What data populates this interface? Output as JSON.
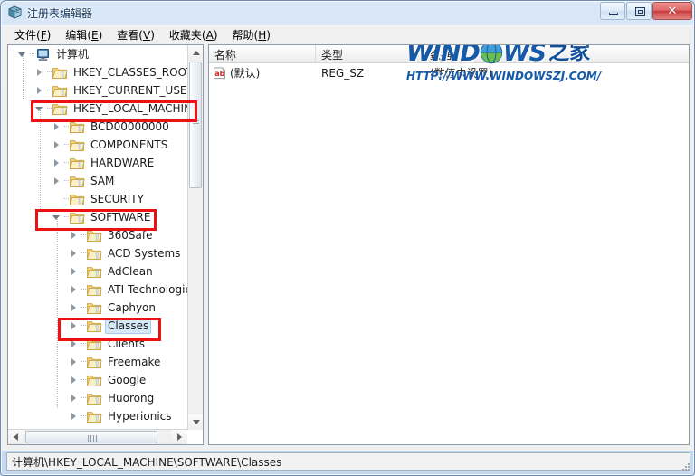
{
  "window": {
    "title": "注册表编辑器",
    "icon": "registry-editor-icon",
    "buttons": {
      "minimize": "最小化",
      "maximize": "还原",
      "close": "关闭",
      "close_glyph": "✕"
    }
  },
  "menubar": {
    "items": [
      {
        "label": "文件",
        "mnemonic": "F"
      },
      {
        "label": "编辑",
        "mnemonic": "E"
      },
      {
        "label": "查看",
        "mnemonic": "V"
      },
      {
        "label": "收藏夹",
        "mnemonic": "A"
      },
      {
        "label": "帮助",
        "mnemonic": "H"
      }
    ]
  },
  "tree": {
    "nodes": [
      {
        "label": "计算机",
        "depth": 0,
        "state": "expanded",
        "icon": "computer-icon"
      },
      {
        "label": "HKEY_CLASSES_ROOT",
        "depth": 1,
        "state": "collapsed",
        "icon": "folder-icon"
      },
      {
        "label": "HKEY_CURRENT_USER",
        "depth": 1,
        "state": "collapsed",
        "icon": "folder-icon"
      },
      {
        "label": "HKEY_LOCAL_MACHINE",
        "depth": 1,
        "state": "expanded",
        "icon": "folder-icon"
      },
      {
        "label": "BCD00000000",
        "depth": 2,
        "state": "collapsed",
        "icon": "folder-icon"
      },
      {
        "label": "COMPONENTS",
        "depth": 2,
        "state": "collapsed",
        "icon": "folder-icon"
      },
      {
        "label": "HARDWARE",
        "depth": 2,
        "state": "collapsed",
        "icon": "folder-icon"
      },
      {
        "label": "SAM",
        "depth": 2,
        "state": "collapsed",
        "icon": "folder-icon"
      },
      {
        "label": "SECURITY",
        "depth": 2,
        "state": "leaf",
        "icon": "folder-icon"
      },
      {
        "label": "SOFTWARE",
        "depth": 2,
        "state": "expanded",
        "icon": "folder-icon"
      },
      {
        "label": "360Safe",
        "depth": 3,
        "state": "collapsed",
        "icon": "folder-icon"
      },
      {
        "label": "ACD Systems",
        "depth": 3,
        "state": "collapsed",
        "icon": "folder-icon"
      },
      {
        "label": "AdClean",
        "depth": 3,
        "state": "collapsed",
        "icon": "folder-icon"
      },
      {
        "label": "ATI Technologie",
        "depth": 3,
        "state": "collapsed",
        "icon": "folder-icon"
      },
      {
        "label": "Caphyon",
        "depth": 3,
        "state": "collapsed",
        "icon": "folder-icon"
      },
      {
        "label": "Classes",
        "depth": 3,
        "state": "collapsed",
        "icon": "folder-icon",
        "selected": true
      },
      {
        "label": "Clients",
        "depth": 3,
        "state": "collapsed",
        "icon": "folder-icon"
      },
      {
        "label": "Freemake",
        "depth": 3,
        "state": "collapsed",
        "icon": "folder-icon"
      },
      {
        "label": "Google",
        "depth": 3,
        "state": "collapsed",
        "icon": "folder-icon"
      },
      {
        "label": "Huorong",
        "depth": 3,
        "state": "collapsed",
        "icon": "folder-icon"
      },
      {
        "label": "Hyperionics",
        "depth": 3,
        "state": "collapsed",
        "icon": "folder-icon"
      }
    ]
  },
  "list": {
    "columns": [
      "名称",
      "类型",
      "数据"
    ],
    "rows": [
      {
        "name": "(默认)",
        "type": "REG_SZ",
        "data": "(数值未设置)",
        "icon": "string-value-icon"
      }
    ]
  },
  "watermark": {
    "brand_part1": "WIND",
    "brand_part2": "WS",
    "brand_suffix": "之家",
    "url": "HTTP://WWW.WINDOWSZJ.COM/"
  },
  "statusbar": {
    "path": "计算机\\HKEY_LOCAL_MACHINE\\SOFTWARE\\Classes"
  },
  "annotations": {
    "labels": [
      "HKEY_LOCAL_MACHINE",
      "SOFTWARE",
      "Classes"
    ],
    "color": "#ee1111"
  },
  "colors": {
    "annotation_red": "#ee1111",
    "selection_blue": "#d6e9f9",
    "window_chrome": "#ccdff3",
    "brand_blue": "#1559a8"
  }
}
